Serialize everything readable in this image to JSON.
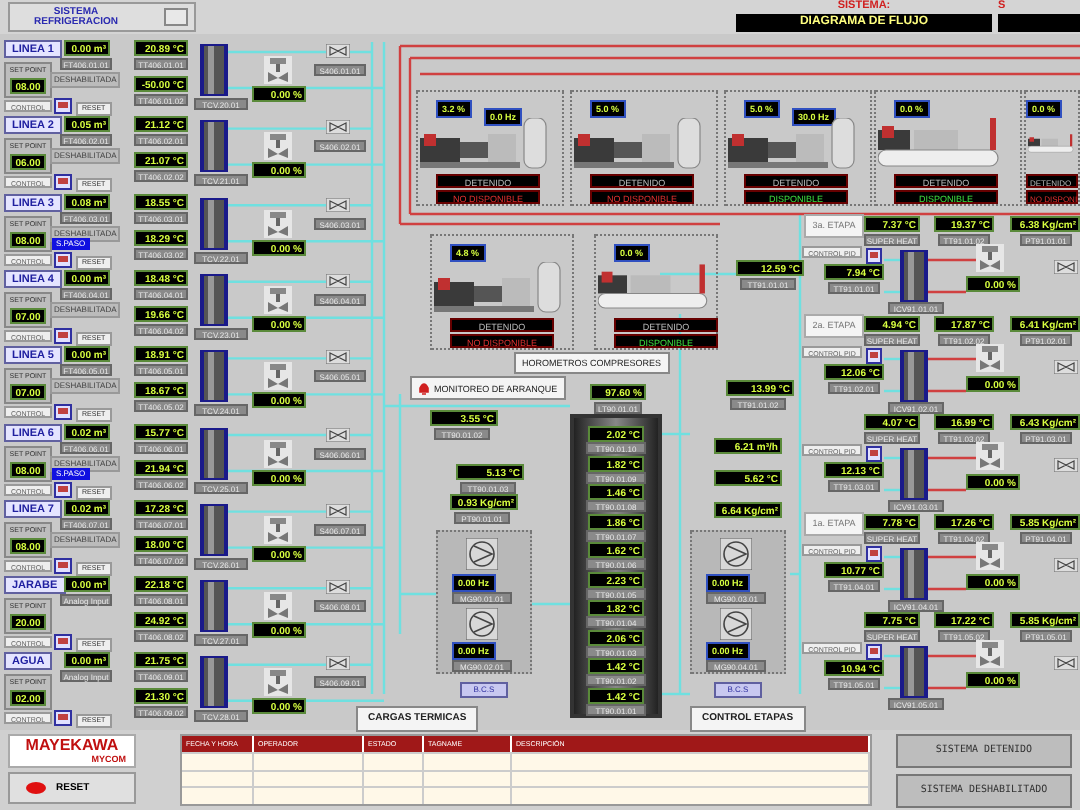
{
  "header": {
    "title": "SISTEMA REFRIGERACION",
    "system_label": "SISTEMA:",
    "system_value": "DIAGRAMA DE FLUJO",
    "system_label_2": "S"
  },
  "lines": [
    {
      "name": "LINEA 1",
      "setpoint_label": "SET POINT",
      "setpoint": "08.00",
      "control": "CONTROL",
      "flow": "0.00 m³",
      "flow_tag": "FT406.01.01",
      "status": "DESHABILITADA",
      "reset": "RESET",
      "temp_1": "20.89 °C",
      "temp_1_tag": "TT406.01.01",
      "temp_2": "-50.00 °C",
      "temp_2_tag": "TT406.01.02",
      "exchanger_tag": "TCV.20.01",
      "valve": "0.00 %",
      "valve_tag": "S406.01.01"
    },
    {
      "name": "LINEA 2",
      "setpoint_label": "SET POINT",
      "setpoint": "06.00",
      "control": "CONTROL",
      "flow": "0.05 m³",
      "flow_tag": "FT406.02.01",
      "status": "DESHABILITADA",
      "reset": "RESET",
      "temp_1": "21.12 °C",
      "temp_1_tag": "TT406.02.01",
      "temp_2": "21.07 °C",
      "temp_2_tag": "TT406.02.02",
      "exchanger_tag": "TCV.21.01",
      "valve": "0.00 %",
      "valve_tag": "S406.02.01"
    },
    {
      "name": "LINEA 3",
      "setpoint_label": "SET POINT",
      "setpoint": "08.00",
      "control": "CONTROL",
      "flow": "0.08 m³",
      "flow_tag": "FT406.03.01",
      "status": "DESHABILITADA",
      "bypass": "S.PASO",
      "reset": "RESET",
      "temp_1": "18.55 °C",
      "temp_1_tag": "TT406.03.01",
      "temp_2": "18.29 °C",
      "temp_2_tag": "TT406.03.02",
      "exchanger_tag": "TCV.22.01",
      "valve": "0.00 %",
      "valve_tag": "S406.03.01"
    },
    {
      "name": "LINEA 4",
      "setpoint_label": "SET POINT",
      "setpoint": "07.00",
      "control": "CONTROL",
      "flow": "0.00 m³",
      "flow_tag": "FT406.04.01",
      "status": "DESHABILITADA",
      "reset": "RESET",
      "temp_1": "18.48 °C",
      "temp_1_tag": "TT406.04.01",
      "temp_2": "19.66 °C",
      "temp_2_tag": "TT406.04.02",
      "exchanger_tag": "TCV.23.01",
      "valve": "0.00 %",
      "valve_tag": "S406.04.01"
    },
    {
      "name": "LINEA 5",
      "setpoint_label": "SET POINT",
      "setpoint": "07.00",
      "control": "CONTROL",
      "flow": "0.00 m³",
      "flow_tag": "FT406.05.01",
      "status": "DESHABILITADA",
      "reset": "RESET",
      "temp_1": "18.91 °C",
      "temp_1_tag": "TT406.05.01",
      "temp_2": "18.67 °C",
      "temp_2_tag": "TT406.05.02",
      "exchanger_tag": "TCV.24.01",
      "valve": "0.00 %",
      "valve_tag": "S406.05.01"
    },
    {
      "name": "LINEA 6",
      "setpoint_label": "SET POINT",
      "setpoint": "08.00",
      "control": "CONTROL",
      "flow": "0.02 m³",
      "flow_tag": "FT406.06.01",
      "status": "DESHABILITADA",
      "bypass": "S.PASO",
      "reset": "RESET",
      "temp_1": "15.77 °C",
      "temp_1_tag": "TT406.06.01",
      "temp_2": "21.94 °C",
      "temp_2_tag": "TT406.06.02",
      "exchanger_tag": "TCV.25.01",
      "valve": "0.00 %",
      "valve_tag": "S406.06.01"
    },
    {
      "name": "LINEA 7",
      "setpoint_label": "SET POINT",
      "setpoint": "08.00",
      "control": "CONTROL",
      "flow": "0.02 m³",
      "flow_tag": "FT406.07.01",
      "status": "DESHABILITADA",
      "reset": "RESET",
      "temp_1": "17.28 °C",
      "temp_1_tag": "TT406.07.01",
      "temp_2": "18.00 °C",
      "temp_2_tag": "TT406.07.02",
      "exchanger_tag": "TCV.26.01",
      "valve": "0.00 %",
      "valve_tag": "S406.07.01"
    },
    {
      "name": "JARABE",
      "setpoint_label": "SET POINT",
      "setpoint": "20.00",
      "control": "CONTROL",
      "flow": "0.00 m³",
      "flow_tag": "Analog Input",
      "reset": "RESET",
      "temp_1": "22.18 °C",
      "temp_1_tag": "TT406.08.01",
      "temp_2": "24.92 °C",
      "temp_2_tag": "TT406.08.02",
      "exchanger_tag": "TCV.27.01",
      "valve": "0.00 %",
      "valve_tag": "S406.08.01"
    },
    {
      "name": "AGUA",
      "setpoint_label": "SET POINT",
      "setpoint": "02.00",
      "control": "CONTROL",
      "flow": "0.00 m³",
      "flow_tag": "Analog Input",
      "reset": "RESET",
      "temp_1": "21.75 °C",
      "temp_1_tag": "TT406.09.01",
      "temp_2": "21.30 °C",
      "temp_2_tag": "TT406.09.02",
      "exchanger_tag": "TCV.28.01",
      "valve": "0.00 %",
      "valve_tag": "S406.09.01"
    }
  ],
  "compressors": [
    {
      "kind": "screw",
      "capacity": "3.2 %",
      "frequency": "0.0 Hz",
      "state": "DETENIDO",
      "availability": "NO DISPONIBLE",
      "available": false
    },
    {
      "kind": "screw",
      "capacity": "5.0 %",
      "state": "DETENIDO",
      "availability": "NO DISPONIBLE",
      "available": false
    },
    {
      "kind": "screw",
      "capacity": "5.0 %",
      "frequency": "30.0 Hz",
      "state": "DETENIDO",
      "availability": "DISPONIBLE",
      "available": true
    },
    {
      "kind": "piston",
      "capacity": "0.0 %",
      "state": "DETENIDO",
      "availability": "DISPONIBLE",
      "available": true
    },
    {
      "kind": "piston",
      "capacity": "0.0 %",
      "state": "DETENIDO",
      "availability": "NO DISPONI",
      "available": false
    },
    {
      "kind": "screw",
      "capacity": "4.8 %",
      "state": "DETENIDO",
      "availability": "NO DISPONIBLE",
      "available": false
    },
    {
      "kind": "piston",
      "capacity": "0.0 %",
      "state": "DETENIDO",
      "availability": "DISPONIBLE",
      "available": true
    }
  ],
  "buttons": {
    "hour_meters": "HOROMETROS COMPRESORES",
    "start_monitor": "MONITOREO DE ARRANQUE",
    "thermal_loads": "CARGAS TERMICAS",
    "stage_control": "CONTROL ETAPAS"
  },
  "tower": {
    "level_reading": "97.60 %",
    "level_tag": "LT90.01.01",
    "readings": [
      {
        "value": "2.02 °C",
        "tag": "TT90.01.10"
      },
      {
        "value": "1.82 °C",
        "tag": "TT90.01.09"
      },
      {
        "value": "1.46 °C",
        "tag": "TT90.01.08"
      },
      {
        "value": "1.86 °C",
        "tag": "TT90.01.07"
      },
      {
        "value": "1.62 °C",
        "tag": "TT90.01.06"
      },
      {
        "value": "2.23 °C",
        "tag": "TT90.01.05"
      },
      {
        "value": "1.82 °C",
        "tag": "TT90.01.04"
      },
      {
        "value": "2.06 °C",
        "tag": "TT90.01.03"
      },
      {
        "value": "1.42 °C",
        "tag": "TT90.01.02"
      },
      {
        "value": "1.42 °C",
        "tag": "TT90.01.01"
      }
    ]
  },
  "left_readings": [
    {
      "value": "3.55 °C",
      "tag": "TT90.01.02"
    },
    {
      "value": "5.13 °C",
      "tag": "TT90.01.03"
    },
    {
      "value": "0.93 Kg/cm²",
      "tag": "PT90.01.01"
    }
  ],
  "right_readings": [
    {
      "value": "12.59 °C",
      "tag": "TT91.01.01"
    },
    {
      "value": "13.99 °C",
      "tag": "TT91.01.02"
    },
    {
      "value": "6.21 m³/h"
    },
    {
      "value": "5.62 °C"
    },
    {
      "value": "6.64 Kg/cm²"
    }
  ],
  "pump_units": [
    {
      "label": "B.C.S",
      "speed_1": "0.00 Hz",
      "tag_1": "MG90.01.01",
      "speed_2": "0.00 Hz",
      "tag_2": "MG90.02.01"
    },
    {
      "label": "B.C.S",
      "speed_1": "0.00 Hz",
      "tag_1": "MG90.03.01",
      "speed_2": "0.00 Hz",
      "tag_2": "MG90.04.01"
    }
  ],
  "stages": [
    {
      "label": "3a. ETAPA",
      "superheat": "7.37 °C",
      "superheat_label": "SUPER HEAT",
      "temp": "19.37 °C",
      "temp_tag": "TT91.01.02",
      "pressure": "6.38 Kg/cm²",
      "pressure_tag": "PT91.01.01",
      "control": "CONTROL PID",
      "inlet": "7.94 °C",
      "inlet_tag": "TT91.01.01",
      "exchanger_tag": "ICV91.01.01",
      "valve": "0.00 %"
    },
    {
      "label": "2a. ETAPA",
      "superheat": "4.94 °C",
      "superheat_label": "SUPER HEAT",
      "temp": "17.87 °C",
      "temp_tag": "TT91.02.02",
      "pressure": "6.41 Kg/cm²",
      "pressure_tag": "PT91.02.01",
      "control": "CONTROL PID",
      "inlet": "12.06 °C",
      "inlet_tag": "TT91.02.01",
      "exchanger_tag": "ICV91.02.01",
      "valve": "0.00 %"
    },
    {
      "superheat": "4.07 °C",
      "superheat_label": "SUPER HEAT",
      "temp": "16.99 °C",
      "temp_tag": "TT91.03.02",
      "pressure": "6.43 Kg/cm²",
      "pressure_tag": "PT91.03.01",
      "control": "CONTROL PID",
      "inlet": "12.13 °C",
      "inlet_tag": "TT91.03.01",
      "exchanger_tag": "ICV91.03.01",
      "valve": "0.00 %"
    },
    {
      "label": "1a. ETAPA",
      "superheat": "7.78 °C",
      "superheat_label": "SUPER HEAT",
      "temp": "17.26 °C",
      "temp_tag": "TT91.04.02",
      "pressure": "5.85 Kg/cm²",
      "pressure_tag": "PT91.04.01",
      "control": "CONTROL PID",
      "inlet": "10.77 °C",
      "inlet_tag": "TT91.04.01",
      "exchanger_tag": "ICV91.04.01",
      "valve": "0.00 %"
    },
    {
      "superheat": "7.75 °C",
      "superheat_label": "SUPER HEAT",
      "temp": "17.22 °C",
      "temp_tag": "TT91.05.02",
      "pressure": "5.85 Kg/cm²",
      "pressure_tag": "PT91.05.01",
      "control": "CONTROL PID",
      "inlet": "10.94 °C",
      "inlet_tag": "TT91.05.01",
      "exchanger_tag": "ICV91.05.01",
      "valve": "0.00 %"
    }
  ],
  "footer": {
    "logo": "MAYEKAWA",
    "logo_sub": "MYCOM",
    "reset": "RESET",
    "alarm_table": {
      "columns": [
        "FECHA Y HORA",
        "OPERADOR",
        "ESTADO",
        "TAGNAME",
        "DESCRIPCIÓN"
      ]
    },
    "status_buttons": [
      "SISTEMA DETENIDO",
      "SISTEMA DESHABILITADO"
    ]
  }
}
